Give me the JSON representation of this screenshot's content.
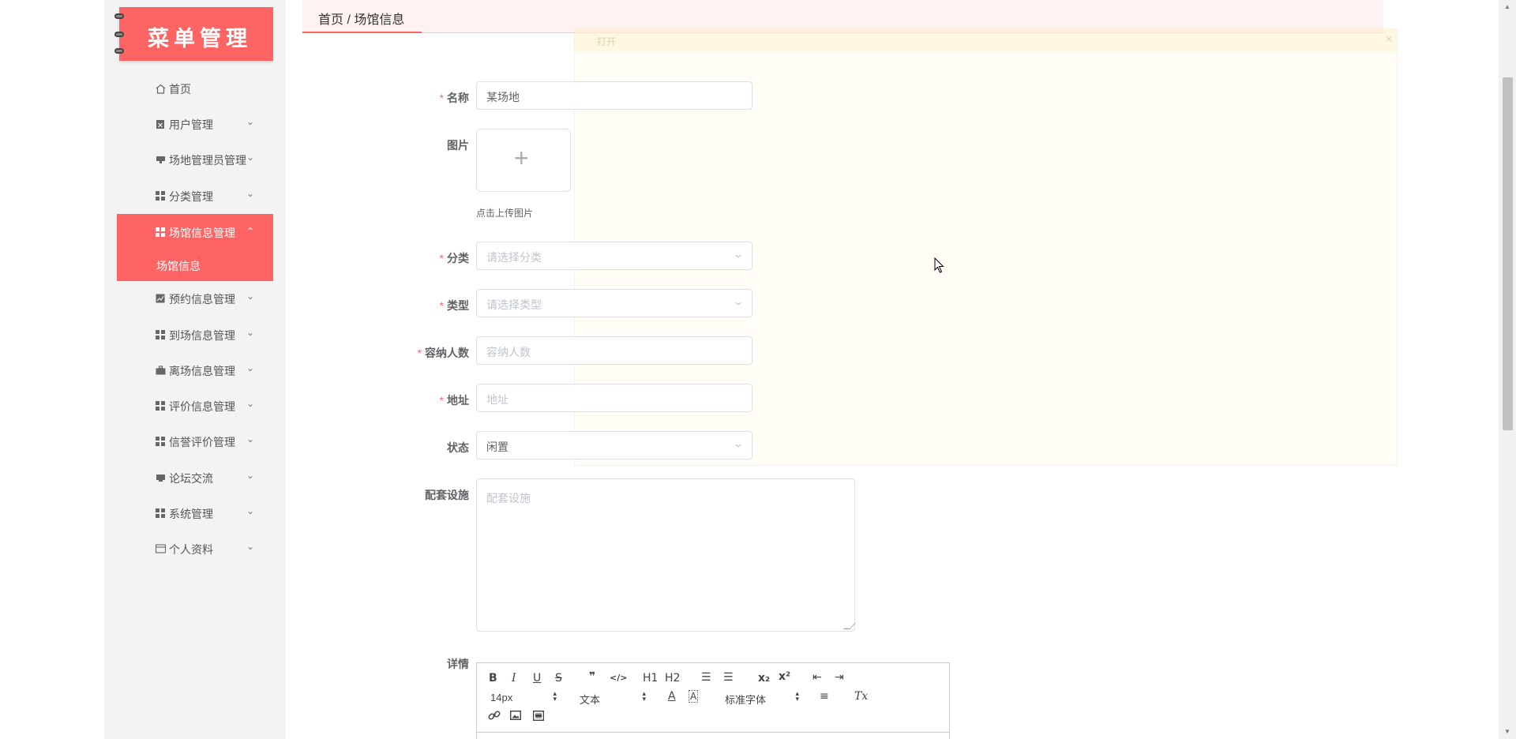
{
  "logo": {
    "text": "菜单管理"
  },
  "sidebar": {
    "items": [
      {
        "label": "首页",
        "icon": "home-icon",
        "arrow": ""
      },
      {
        "label": "用户管理",
        "icon": "user-doc-icon",
        "arrow": "⌄"
      },
      {
        "label": "场地管理员管理",
        "icon": "monitor-icon",
        "arrow": "⌄"
      },
      {
        "label": "分类管理",
        "icon": "grid-icon",
        "arrow": "⌄"
      },
      {
        "label": "场馆信息管理",
        "icon": "grid-icon",
        "arrow": "⌃"
      },
      {
        "label": "预约信息管理",
        "icon": "chart-icon",
        "arrow": "⌄"
      },
      {
        "label": "到场信息管理",
        "icon": "grid-icon",
        "arrow": "⌄"
      },
      {
        "label": "离场信息管理",
        "icon": "briefcase-icon",
        "arrow": "⌄"
      },
      {
        "label": "评价信息管理",
        "icon": "grid-icon",
        "arrow": "⌄"
      },
      {
        "label": "信誉评价管理",
        "icon": "grid-icon",
        "arrow": "⌄"
      },
      {
        "label": "论坛交流",
        "icon": "monitor-icon",
        "arrow": "⌄"
      },
      {
        "label": "系统管理",
        "icon": "grid-icon",
        "arrow": "⌄"
      },
      {
        "label": "个人资料",
        "icon": "card-icon",
        "arrow": "⌄"
      }
    ],
    "sub_item": "场馆信息"
  },
  "breadcrumb": {
    "text": "首页 / 场馆信息"
  },
  "ghost_dialog": {
    "title": "打开",
    "close": "×"
  },
  "form": {
    "name_label": "名称",
    "name_value": "某场地",
    "image_label": "图片",
    "upload_tip": "点击上传图片",
    "category_label": "分类",
    "category_placeholder": "请选择分类",
    "type_label": "类型",
    "type_placeholder": "请选择类型",
    "capacity_label": "容纳人数",
    "capacity_placeholder": "容纳人数",
    "address_label": "地址",
    "address_placeholder": "地址",
    "status_label": "状态",
    "status_value": "闲置",
    "facilities_label": "配套设施",
    "facilities_placeholder": "配套设施",
    "details_label": "详情",
    "required_mark": "*"
  },
  "editor": {
    "bold": "B",
    "italic": "I",
    "underline": "U",
    "strike": "S",
    "quote": "❞",
    "code": "</>",
    "h1": "H1",
    "h2": "H2",
    "ordered_list": "☰",
    "bullet_list": "☰",
    "subscript": "x₂",
    "superscript": "x²",
    "outdent": "⇤",
    "indent": "⇥",
    "size": "14px",
    "paragraph": "文本",
    "font": "标准字体",
    "color": "A",
    "background": "A",
    "align": "≡",
    "clean": "Tx",
    "link": "🔗",
    "image": "▣",
    "video": "▦"
  }
}
